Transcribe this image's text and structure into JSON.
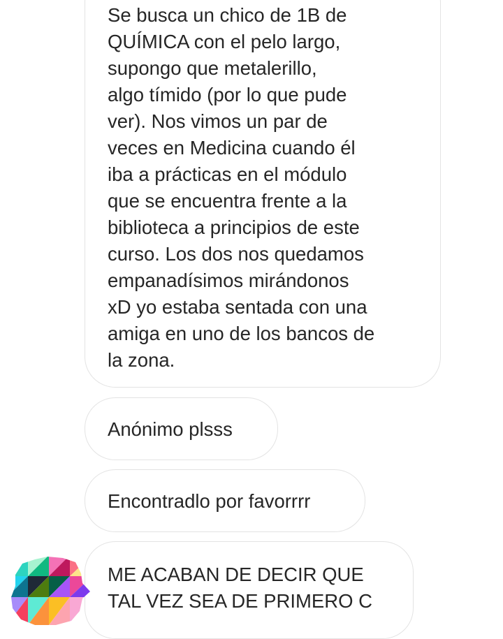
{
  "conversation": {
    "messages": [
      {
        "text": "Se busca un chico de 1B de\nQUÍMICA con el pelo largo,\nsupongo que metalerillo,\nalgo tímido (por lo que pude\nver). Nos vimos un par de\nveces en Medicina cuando él\niba a prácticas en el módulo\nque se encuentra frente a la\nbiblioteca a principios de este\ncurso. Los dos nos quedamos\nempanadísimos mirándonos\nxD yo estaba sentada con una\namiga en uno de los bancos de\nla zona."
      },
      {
        "text": "Anónimo plsss"
      },
      {
        "text": "Encontradlo por favorrrr"
      },
      {
        "text": "ME ACABAN DE DECIR QUE\nTAL VEZ SEA DE PRIMERO C"
      }
    ]
  },
  "colors": {
    "bubble_border": "#e3e3e3",
    "text": "#262626",
    "background": "#ffffff"
  },
  "icons": {
    "avatar": "profile-avatar-colorful-triangles"
  }
}
